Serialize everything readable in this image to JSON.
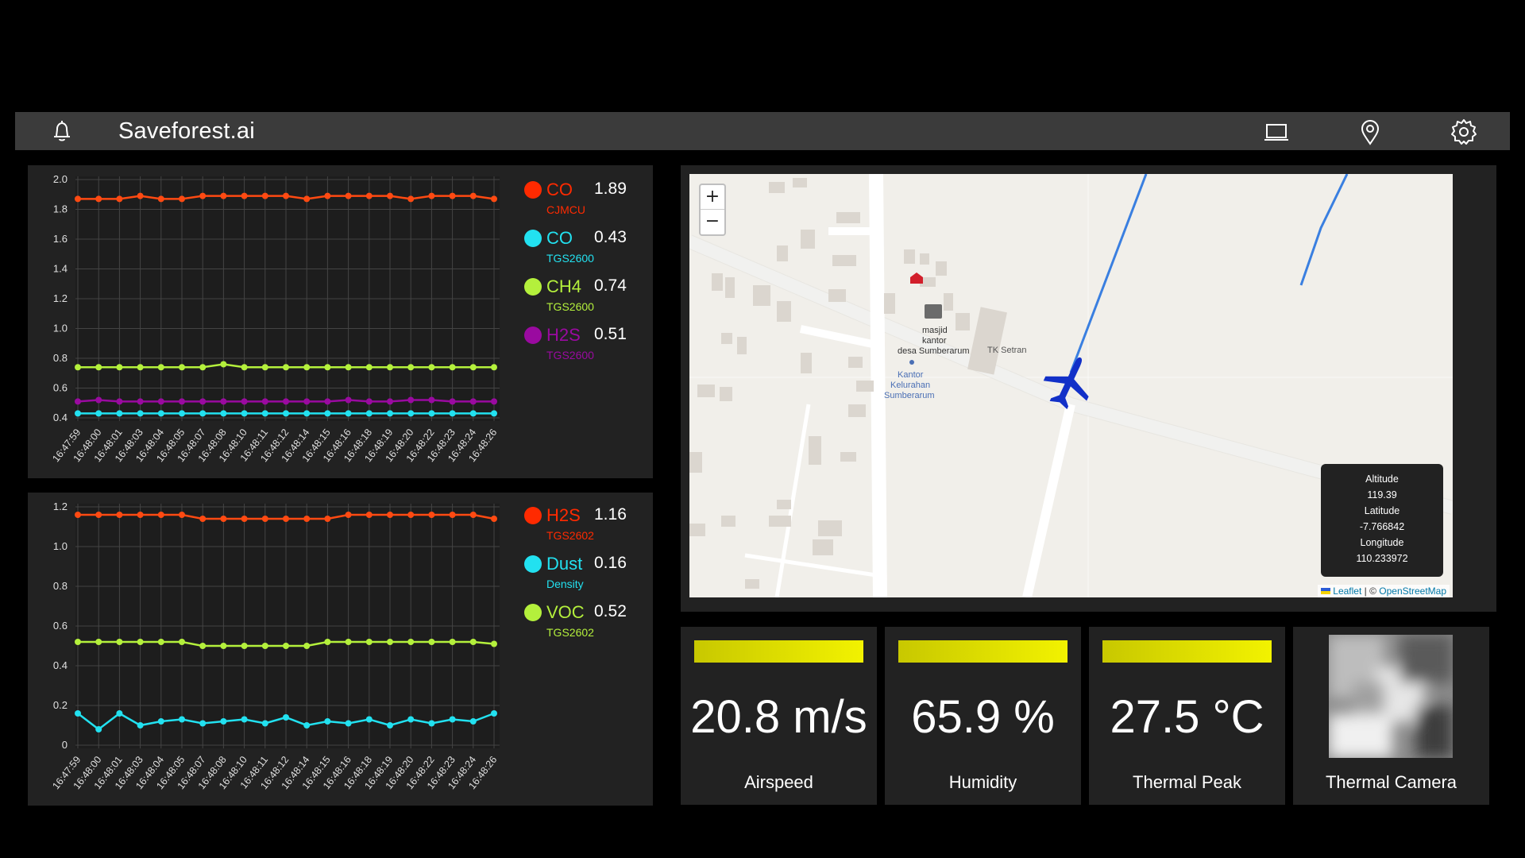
{
  "app": {
    "title": "Saveforest.ai",
    "icons": [
      "bell-icon",
      "laptop-icon",
      "map-pin-icon",
      "gear-icon"
    ]
  },
  "chart1": {
    "legend": [
      {
        "name": "CO",
        "sub": "CJMCU",
        "value": "1.89",
        "color": "#ff2a00"
      },
      {
        "name": "CO",
        "sub": "TGS2600",
        "value": "0.43",
        "color": "#22e1f0"
      },
      {
        "name": "CH4",
        "sub": "TGS2600",
        "value": "0.74",
        "color": "#b4f03c"
      },
      {
        "name": "H2S",
        "sub": "TGS2600",
        "value": "0.51",
        "color": "#9a0aa0"
      }
    ]
  },
  "chart2": {
    "legend": [
      {
        "name": "H2S",
        "sub": "TGS2602",
        "value": "1.16",
        "color": "#ff2a00"
      },
      {
        "name": "Dust",
        "sub": "Density",
        "value": "0.16",
        "color": "#22e1f0"
      },
      {
        "name": "VOC",
        "sub": "TGS2602",
        "value": "0.52",
        "color": "#b4f03c"
      }
    ]
  },
  "chart_data": [
    {
      "type": "line",
      "categories": [
        "16:47:59",
        "16:48:00",
        "16:48:01",
        "16:48:03",
        "16:48:04",
        "16:48:05",
        "16:48:07",
        "16:48:08",
        "16:48:10",
        "16:48:11",
        "16:48:12",
        "16:48:14",
        "16:48:15",
        "16:48:16",
        "16:48:18",
        "16:48:19",
        "16:48:20",
        "16:48:22",
        "16:48:23",
        "16:48:24",
        "16:48:26"
      ],
      "ylim": [
        0.4,
        2.0
      ],
      "yticks": [
        "2.0",
        "1.8",
        "1.6",
        "1.4",
        "1.2",
        "1.0",
        "0.8",
        "0.6",
        "0.4"
      ],
      "grid": true,
      "series": [
        {
          "name": "CO CJMCU",
          "color": "#ff4a12",
          "values": [
            1.87,
            1.87,
            1.87,
            1.89,
            1.87,
            1.87,
            1.89,
            1.89,
            1.89,
            1.89,
            1.89,
            1.87,
            1.89,
            1.89,
            1.89,
            1.89,
            1.87,
            1.89,
            1.89,
            1.89,
            1.87
          ]
        },
        {
          "name": "CH4 TGS2600",
          "color": "#b4f03c",
          "values": [
            0.74,
            0.74,
            0.74,
            0.74,
            0.74,
            0.74,
            0.74,
            0.76,
            0.74,
            0.74,
            0.74,
            0.74,
            0.74,
            0.74,
            0.74,
            0.74,
            0.74,
            0.74,
            0.74,
            0.74,
            0.74
          ]
        },
        {
          "name": "H2S TGS2600",
          "color": "#9a0aa0",
          "values": [
            0.51,
            0.52,
            0.51,
            0.51,
            0.51,
            0.51,
            0.51,
            0.51,
            0.51,
            0.51,
            0.51,
            0.51,
            0.51,
            0.52,
            0.51,
            0.51,
            0.52,
            0.52,
            0.51,
            0.51,
            0.51
          ]
        },
        {
          "name": "CO TGS2600",
          "color": "#22e1f0",
          "values": [
            0.43,
            0.43,
            0.43,
            0.43,
            0.43,
            0.43,
            0.43,
            0.43,
            0.43,
            0.43,
            0.43,
            0.43,
            0.43,
            0.43,
            0.43,
            0.43,
            0.43,
            0.43,
            0.43,
            0.43,
            0.43
          ]
        }
      ]
    },
    {
      "type": "line",
      "categories": [
        "16:47:59",
        "16:48:00",
        "16:48:01",
        "16:48:03",
        "16:48:04",
        "16:48:05",
        "16:48:07",
        "16:48:08",
        "16:48:10",
        "16:48:11",
        "16:48:12",
        "16:48:14",
        "16:48:15",
        "16:48:16",
        "16:48:18",
        "16:48:19",
        "16:48:20",
        "16:48:22",
        "16:48:23",
        "16:48:24",
        "16:48:26"
      ],
      "ylim": [
        0,
        1.2
      ],
      "yticks": [
        "1.2",
        "1.0",
        "0.8",
        "0.6",
        "0.4",
        "0.2",
        "0"
      ],
      "grid": true,
      "series": [
        {
          "name": "H2S TGS2602",
          "color": "#ff4a12",
          "values": [
            1.16,
            1.16,
            1.16,
            1.16,
            1.16,
            1.16,
            1.14,
            1.14,
            1.14,
            1.14,
            1.14,
            1.14,
            1.14,
            1.16,
            1.16,
            1.16,
            1.16,
            1.16,
            1.16,
            1.16,
            1.14
          ]
        },
        {
          "name": "VOC TGS2602",
          "color": "#b4f03c",
          "values": [
            0.52,
            0.52,
            0.52,
            0.52,
            0.52,
            0.52,
            0.5,
            0.5,
            0.5,
            0.5,
            0.5,
            0.5,
            0.52,
            0.52,
            0.52,
            0.52,
            0.52,
            0.52,
            0.52,
            0.52,
            0.51
          ]
        },
        {
          "name": "Dust Density",
          "color": "#22e1f0",
          "values": [
            0.16,
            0.08,
            0.16,
            0.1,
            0.12,
            0.13,
            0.11,
            0.12,
            0.13,
            0.11,
            0.14,
            0.1,
            0.12,
            0.11,
            0.13,
            0.1,
            0.13,
            0.11,
            0.13,
            0.12,
            0.16
          ]
        }
      ]
    }
  ],
  "map": {
    "zoom_in": "+",
    "zoom_out": "−",
    "labels": {
      "masjid": "masjid",
      "kantor": "kantor",
      "desa": "desa Sumberarum",
      "tk": "TK Setran",
      "kantor2": "Kantor",
      "kelurahan": "Kelurahan",
      "sumberarum": "Sumberarum"
    },
    "info": {
      "altitude_label": "Altitude",
      "altitude": "119.39",
      "latitude_label": "Latitude",
      "latitude": "-7.766842",
      "longitude_label": "Longitude",
      "longitude": "110.233972"
    },
    "attribution": {
      "leaflet": "Leaflet",
      "sep": " | © ",
      "osm": "OpenStreetMap"
    }
  },
  "tiles": [
    {
      "value": "20.8 m/s",
      "caption": "Airspeed",
      "fill": 1.0
    },
    {
      "value": "65.9 %",
      "caption": "Humidity",
      "fill": 1.0
    },
    {
      "value": "27.5 °C",
      "caption": "Thermal Peak",
      "fill": 1.0
    }
  ],
  "thermal_camera": {
    "caption": "Thermal Camera"
  }
}
